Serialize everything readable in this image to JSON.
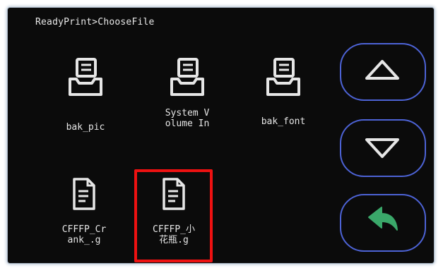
{
  "breadcrumb": "ReadyPrint>ChooseFile",
  "files": [
    {
      "label": "bak_pic",
      "icon": "folder-icon"
    },
    {
      "label": "System V\nolume In",
      "icon": "folder-icon"
    },
    {
      "label": "bak_font",
      "icon": "folder-icon"
    },
    {
      "label": "CFFFP_Cr\nank_.g",
      "icon": "file-icon"
    },
    {
      "label": "CFFFP_小\n花瓶.g",
      "icon": "file-icon",
      "selected": true
    }
  ],
  "nav": {
    "up_icon": "arrow-up-icon",
    "down_icon": "arrow-down-icon",
    "back_icon": "back-arrow-icon"
  },
  "colors": {
    "screen_bg": "#0b0b0b",
    "text": "#e6e6e6",
    "button_border": "#4d63d6",
    "back_arrow": "#3aa86a",
    "selection": "#ee1111"
  }
}
